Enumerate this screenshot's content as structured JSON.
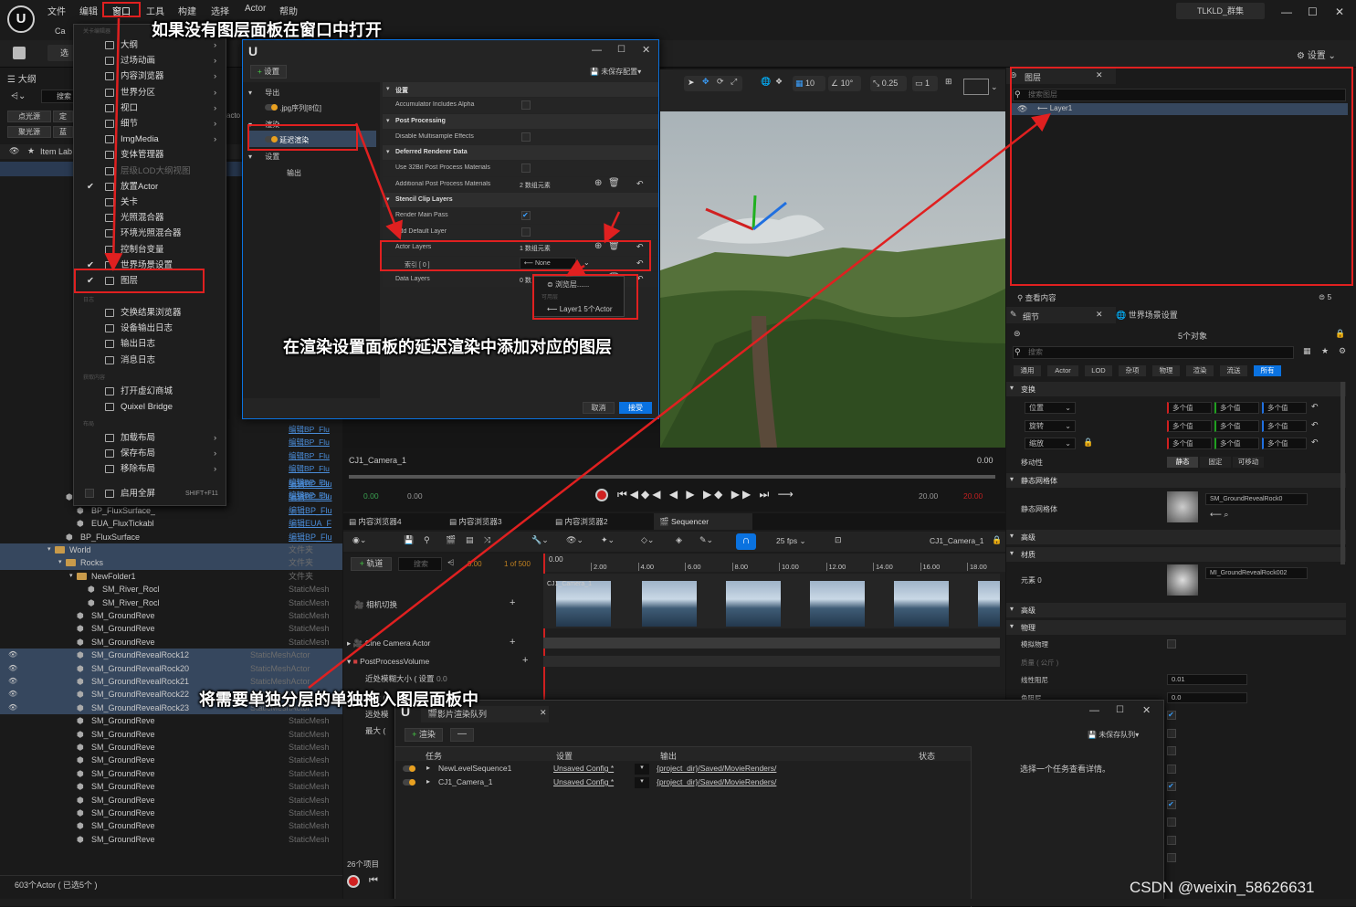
{
  "title_bar": {
    "menus": [
      "文件",
      "编辑",
      "窗口",
      "工具",
      "构建",
      "选择",
      "Actor",
      "帮助"
    ],
    "project": "TLKLD_群集",
    "settings_label": "设置"
  },
  "toolbar": {
    "tab_prefix": "Ca",
    "select_label": "选"
  },
  "window_menu": {
    "section_header_small": "关卡编辑器",
    "items": [
      {
        "label": "大纲",
        "arrow": true
      },
      {
        "label": "过场动画",
        "arrow": true
      },
      {
        "label": "内容浏览器",
        "arrow": true
      },
      {
        "label": "世界分区",
        "arrow": true
      },
      {
        "label": "视口",
        "arrow": true
      },
      {
        "label": "细节",
        "arrow": true
      },
      {
        "label": "ImgMedia",
        "arrow": true
      },
      {
        "label": "变体管理器",
        "arrow": false
      },
      {
        "label": "层级LOD大纲视图",
        "arrow": false,
        "dim": true
      },
      {
        "label": "放置Actor",
        "arrow": false,
        "checked": true
      },
      {
        "label": "关卡",
        "arrow": false
      },
      {
        "label": "光照混合器",
        "arrow": false
      },
      {
        "label": "环境光照混合器",
        "arrow": false
      },
      {
        "label": "控制台变量",
        "arrow": false
      },
      {
        "label": "世界场景设置",
        "arrow": false,
        "checked": true
      },
      {
        "label": "图层",
        "arrow": false,
        "checked": true
      }
    ],
    "items2": [
      "交换结果浏览器",
      "设备输出日志",
      "输出日志",
      "消息日志"
    ],
    "items3": [
      "打开虚幻商城",
      "Quixel Bridge"
    ],
    "layout_items": [
      "加载布局",
      "保存布局",
      "移除布局"
    ],
    "fullscreen_label": "启用全屏",
    "fullscreen_shortcut": "SHIFT+F11",
    "header_log": "日志",
    "header_content": "获取内容",
    "header_layout": "布局"
  },
  "render_settings": {
    "add_setting": "设置",
    "unsaved_config": "未保存配置",
    "left_tree": [
      {
        "label": "导出",
        "level": 0
      },
      {
        "label": ".jpg序列[8位]",
        "level": 1
      },
      {
        "label": "渲染",
        "level": 0
      },
      {
        "label": "延迟渲染",
        "level": 1,
        "selected": true
      },
      {
        "label": "设置",
        "level": 0
      },
      {
        "label": "输出",
        "level": 1
      }
    ],
    "rows": [
      {
        "label": "设置",
        "kind": "section"
      },
      {
        "label": "Accumulator Includes Alpha",
        "kind": "check"
      },
      {
        "label": "Post Processing",
        "kind": "section"
      },
      {
        "label": "Disable Multisample Effects",
        "kind": "check"
      },
      {
        "label": "Deferred Renderer Data",
        "kind": "section"
      },
      {
        "label": "Use 32Bit Post Process Materials",
        "kind": "check"
      },
      {
        "label": "Additional Post Process Materials",
        "kind": "value",
        "value": "2 数组元素"
      },
      {
        "label": "Stencil Clip Layers",
        "kind": "section"
      },
      {
        "label": "Render Main Pass",
        "kind": "check",
        "checked": true
      },
      {
        "label": "Add Default Layer",
        "kind": "check"
      },
      {
        "label": "Actor Layers",
        "kind": "value",
        "value": "1 数组元素"
      },
      {
        "label": "索引 [ 0 ]",
        "kind": "dropdown",
        "value": "None"
      },
      {
        "label": "Data Layers",
        "kind": "value",
        "value": "0 数"
      }
    ],
    "popup_browse": "浏览层......",
    "popup_header": "可用层",
    "popup_layer": "Layer1 5个Actor",
    "cancel": "取消",
    "accept": "接受"
  },
  "viewport_toolbar": {
    "grid": "10",
    "angle": "10°",
    "scale": "0.25",
    "camera_speed": "1"
  },
  "sequencer": {
    "camera_name": "CJ1_Camera_1",
    "time_right": "0.00",
    "tc_left_green": "0.00",
    "tc_left_grey": "0.00",
    "tc_right_grey": "20.00",
    "tc_right_red": "20.00",
    "tabs": [
      "内容浏览器4",
      "内容浏览器3",
      "内容浏览器2",
      "Sequencer"
    ],
    "fps": "25 fps",
    "track_label": "轨道",
    "search_placeholder": "搜索",
    "frame_current": "0.00",
    "frame_total": "1 of 500",
    "ruler_start": "0.00",
    "ruler_ticks": [
      "2.00",
      "4.00",
      "6.00",
      "8.00",
      "10.00",
      "12.00",
      "14.00",
      "16.00",
      "18.00"
    ],
    "tracks": [
      "相机切换",
      "Cine Camera Actor",
      "PostProcessVolume",
      "近处模糊大小 ( 设置",
      "数量 (",
      "远处模",
      "最大 ("
    ],
    "track_value": "0.0",
    "camera_overlay": "CJ1_Camera_1",
    "items_count": "26个项目"
  },
  "outliner": {
    "title": "大纲",
    "search_placeholder": "搜索",
    "filter_chips": [
      "点光源",
      "定",
      "聚光源",
      "蓝"
    ],
    "column_label": "Item Lab",
    "column_actor": "acto",
    "rows": [
      {
        "name": "BP_FluxModifierCo",
        "type": "编辑BP_Flu",
        "link": true,
        "indent": 2
      },
      {
        "name": "BP_FluxSimulation",
        "type": "编辑BP_Flu",
        "link": true,
        "indent": 1
      },
      {
        "name": "BP_FluxSurface_",
        "type": "编辑BP_Flu",
        "link": true,
        "indent": 2
      },
      {
        "name": "EUA_FluxTickabl",
        "type": "编辑EUA_F",
        "link": true,
        "indent": 2
      },
      {
        "name": "BP_FluxSurface",
        "type": "编辑BP_Flu",
        "link": true,
        "indent": 1
      },
      {
        "name": "World",
        "type": "文件夹",
        "folder": true,
        "indent": 0,
        "sel": true
      },
      {
        "name": "Rocks",
        "type": "文件夹",
        "folder": true,
        "indent": 1,
        "sel": true
      },
      {
        "name": "NewFolder1",
        "type": "文件夹",
        "folder": true,
        "indent": 2
      },
      {
        "name": "SM_River_Rocl",
        "type": "StaticMesh",
        "indent": 3
      },
      {
        "name": "SM_River_Rocl",
        "type": "StaticMesh",
        "indent": 3
      },
      {
        "name": "SM_GroundReve",
        "type": "StaticMesh",
        "indent": 2
      },
      {
        "name": "SM_GroundReve",
        "type": "StaticMesh",
        "indent": 2
      },
      {
        "name": "SM_GroundReve",
        "type": "StaticMesh",
        "indent": 2
      },
      {
        "name": "SM_GroundRevealRock12",
        "type": "StaticMeshActor",
        "indent": 2,
        "sel": true
      },
      {
        "name": "SM_GroundRevealRock20",
        "type": "StaticMeshActor",
        "indent": 2,
        "sel": true
      },
      {
        "name": "SM_GroundRevealRock21",
        "type": "StaticMeshActor",
        "indent": 2,
        "sel": true
      },
      {
        "name": "SM_GroundRevealRock22",
        "type": "StaticMeshActor",
        "indent": 2,
        "sel": true
      },
      {
        "name": "SM_GroundRevealRock23",
        "type": "StaticMeshActor",
        "indent": 2,
        "sel": true
      },
      {
        "name": "SM_GroundReve",
        "type": "StaticMesh",
        "indent": 2
      },
      {
        "name": "SM_GroundReve",
        "type": "StaticMesh",
        "indent": 2
      },
      {
        "name": "SM_GroundReve",
        "type": "StaticMesh",
        "indent": 2
      },
      {
        "name": "SM_GroundReve",
        "type": "StaticMesh",
        "indent": 2
      },
      {
        "name": "SM_GroundReve",
        "type": "StaticMesh",
        "indent": 2
      },
      {
        "name": "SM_GroundReve",
        "type": "StaticMesh",
        "indent": 2
      },
      {
        "name": "SM_GroundReve",
        "type": "StaticMesh",
        "indent": 2
      },
      {
        "name": "SM_GroundReve",
        "type": "StaticMesh",
        "indent": 2
      },
      {
        "name": "SM_GroundReve",
        "type": "StaticMesh",
        "indent": 2
      },
      {
        "name": "SM_GroundReve",
        "type": "StaticMesh",
        "indent": 2
      }
    ],
    "upper_types": [
      "编辑BP_Flu",
      "编辑BP_Flu",
      "编辑BP_Flu",
      "编辑BP_Flu",
      "编辑BP_Flu",
      "编辑BP_Flu"
    ],
    "footer": "603个Actor ( 已选5个 )"
  },
  "layers": {
    "title": "图层",
    "search_placeholder": "搜索图层",
    "layer_name": "Layer1",
    "view_content": "查看内容",
    "count": "5"
  },
  "details": {
    "tab_details": "细节",
    "tab_world": "世界场景设置",
    "objects": "5个对象",
    "search_placeholder": "搜索",
    "filters": [
      "通用",
      "Actor",
      "LOD",
      "杂项",
      "物理",
      "渲染",
      "流送",
      "所有"
    ],
    "section_transform": "变换",
    "transform_rows": [
      "位置",
      "旋转",
      "缩放"
    ],
    "multi_value": "多个值",
    "mobility_label": "移动性",
    "mobility_opts": [
      "静态",
      "固定",
      "可移动"
    ],
    "section_static_mesh": "静态网格体",
    "static_mesh_label": "静态网格体",
    "static_mesh_value": "SM_GroundRevealRock0",
    "section_advanced": "高级",
    "section_materials": "材质",
    "element_label": "元素 0",
    "material_value": "MI_GroundRevealRock002",
    "section_advanced2": "高级",
    "section_physics": "物理",
    "physics_rows": [
      "模拟物理",
      "质量 ( 公斤 )",
      "线性阻尼",
      "角阻尼"
    ],
    "linear_damping": "0.01",
    "angular_damping": "0.0"
  },
  "queue": {
    "title": "影片渲染队列",
    "render_btn": "渲染",
    "unsaved_queue": "未保存队列",
    "columns": [
      "任务",
      "设置",
      "输出",
      "状态"
    ],
    "jobs": [
      {
        "name": "NewLevelSequence1",
        "config": "Unsaved Config *",
        "output": "{project_dir}/Saved/MovieRenders/"
      },
      {
        "name": "CJ1_Camera_1",
        "config": "Unsaved Config *",
        "output": "{project_dir}/Saved/MovieRenders/"
      }
    ],
    "hint": "选择一个任务查看详情。"
  },
  "annotations": {
    "top": "如果没有图层面板在窗口中打开",
    "middle": "在渲染设置面板的延迟渲染中添加对应的图层",
    "bottom": "将需要单独分层的单独拖入图层面板中"
  },
  "watermark": "CSDN @weixin_58626631",
  "bottom_status": {
    "items": [
      "内容侧滑菜单",
      "输出日志",
      "Cmd",
      "输入控制台命令"
    ]
  }
}
